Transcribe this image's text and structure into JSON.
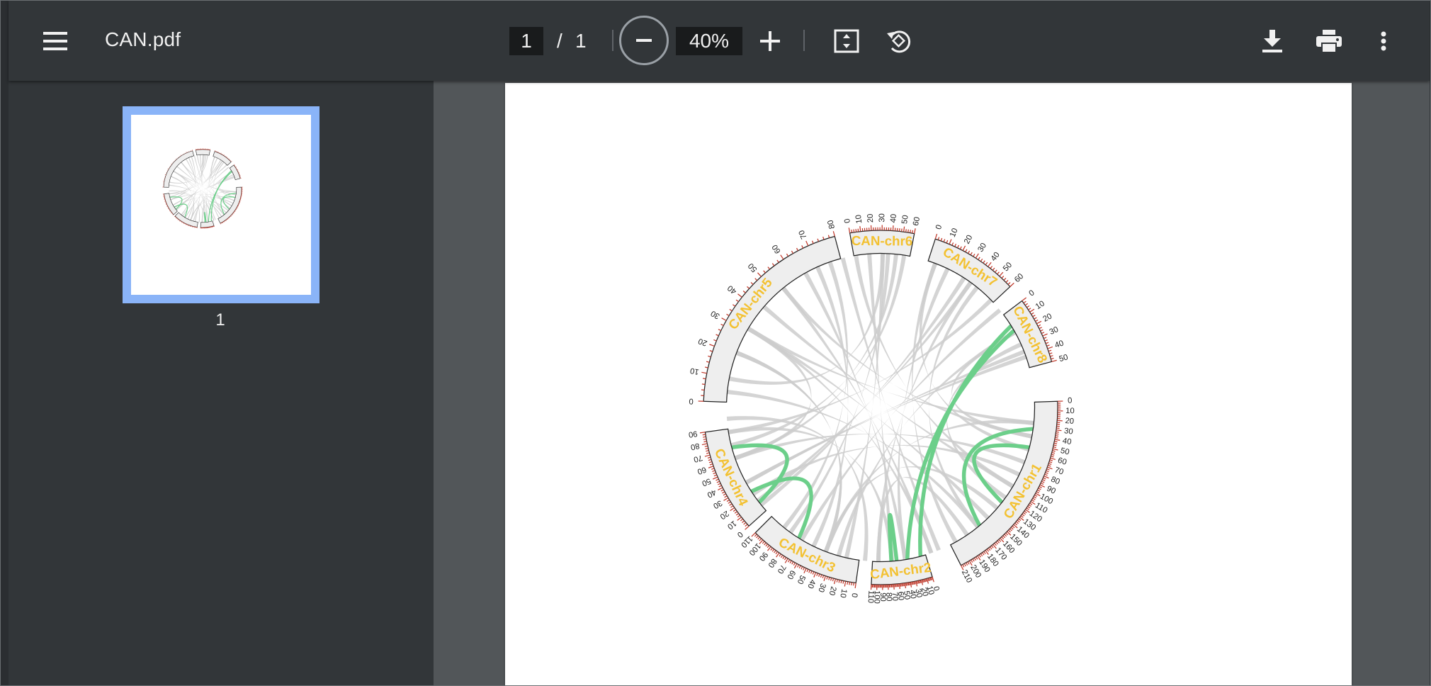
{
  "toolbar": {
    "title": "CAN.pdf",
    "current_page": "1",
    "page_separator": "/",
    "total_pages": "1",
    "zoom": "40%",
    "icons": [
      "menu-icon",
      "zoom-out-icon",
      "zoom-in-icon",
      "fit-page-icon",
      "rotate-icon",
      "download-icon",
      "print-icon",
      "more-vert-icon"
    ]
  },
  "sidebar": {
    "thumbnails": [
      {
        "label": "1",
        "selected": true
      }
    ],
    "selected_border_color": "#8ab4f8"
  },
  "document": {
    "figure": "circos plot",
    "chromosomes": [
      {
        "label": "CAN-chr1",
        "ticks": [
          "0",
          "10",
          "20",
          "30",
          "40",
          "50",
          "60",
          "70",
          "80",
          "90",
          "100",
          "110",
          "120",
          "130",
          "140",
          "150",
          "160",
          "170",
          "180",
          "190",
          "200",
          "210"
        ]
      },
      {
        "label": "CAN-chr2",
        "ticks": [
          "0",
          "10",
          "20",
          "30",
          "40",
          "50",
          "60",
          "70",
          "80",
          "90",
          "100",
          "110"
        ]
      },
      {
        "label": "CAN-chr3",
        "ticks": [
          "0",
          "10",
          "20",
          "30",
          "40",
          "50",
          "60",
          "70",
          "80",
          "90",
          "100",
          "110"
        ]
      },
      {
        "label": "CAN-chr4",
        "ticks": [
          "0",
          "10",
          "20",
          "30",
          "40",
          "50",
          "60",
          "70",
          "80",
          "90"
        ]
      },
      {
        "label": "CAN-chr5",
        "ticks": [
          "0",
          "10",
          "20",
          "30",
          "40",
          "50",
          "60",
          "70",
          "80"
        ]
      },
      {
        "label": "CAN-chr6",
        "ticks": [
          "0",
          "10",
          "20",
          "30",
          "40",
          "50",
          "60"
        ]
      },
      {
        "label": "CAN-chr7",
        "ticks": [
          "0",
          "10",
          "20",
          "30",
          "40",
          "50",
          "60"
        ]
      },
      {
        "label": "CAN-chr8",
        "ticks": [
          "0",
          "10",
          "20",
          "30",
          "40",
          "50"
        ]
      }
    ],
    "colors": {
      "label": "#f3c131",
      "tick": "#c0392b",
      "sector_fill": "#eeeeee",
      "link_gray": "#cccccc",
      "link_green": "#6ccf8a"
    }
  }
}
